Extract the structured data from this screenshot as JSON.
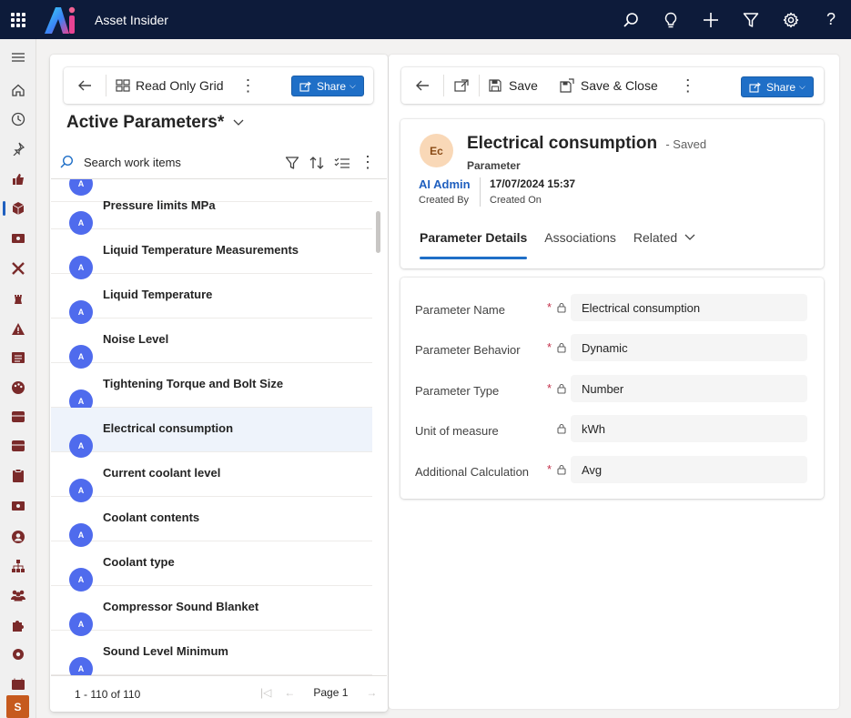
{
  "app": {
    "title": "Asset Insider"
  },
  "topbar": {
    "icons": [
      "search-icon",
      "lightbulb-icon",
      "plus-icon",
      "filter-icon",
      "settings-icon",
      "help-icon"
    ],
    "help_glyph": "?"
  },
  "leftnav": {
    "icons": [
      "hamburger-icon",
      "home-icon",
      "recent-icon",
      "pin-icon",
      "thumbs-up-icon",
      "cube-icon",
      "ticket-icon",
      "tools-icon",
      "chess-icon",
      "warning-icon",
      "list-icon",
      "palette-icon",
      "box-icon",
      "box-icon-2",
      "clipboard-icon",
      "ticket-icon-2",
      "contact-icon",
      "hierarchy-icon",
      "people-icon",
      "puzzle-icon",
      "gear-icon",
      "calendar-icon"
    ],
    "user_initial": "S"
  },
  "list_panel": {
    "toolbar": {
      "view_label": "Read Only Grid",
      "share_label": "Share"
    },
    "view_title": "Active Parameters*",
    "search_placeholder": "Search work items",
    "items": [
      {
        "initial": "A",
        "label": "Pressure limits MPa"
      },
      {
        "initial": "A",
        "label": "Liquid Temperature Measurements"
      },
      {
        "initial": "A",
        "label": "Liquid Temperature"
      },
      {
        "initial": "A",
        "label": "Noise Level"
      },
      {
        "initial": "A",
        "label": "Tightening Torque and Bolt Size"
      },
      {
        "initial": "A",
        "label": "Electrical consumption"
      },
      {
        "initial": "A",
        "label": "Current coolant level"
      },
      {
        "initial": "A",
        "label": "Coolant contents"
      },
      {
        "initial": "A",
        "label": "Coolant type"
      },
      {
        "initial": "A",
        "label": "Compressor Sound Blanket"
      },
      {
        "initial": "A",
        "label": "Sound Level Minimum"
      }
    ],
    "selected_index": 5,
    "footer": {
      "count_text": "1 - 110 of 110",
      "page_text": "Page 1"
    }
  },
  "record": {
    "toolbar": {
      "save_label": "Save",
      "save_close_label": "Save & Close",
      "share_label": "Share"
    },
    "avatar_initials": "Ec",
    "title": "Electrical consumption",
    "saved_status": "- Saved",
    "entity": "Parameter",
    "created_by_value": "AI Admin",
    "created_by_label": "Created By",
    "created_on_value": "17/07/2024 15:37",
    "created_on_label": "Created On",
    "tabs": [
      "Parameter Details",
      "Associations",
      "Related"
    ],
    "fields": [
      {
        "label": "Parameter Name",
        "required": "*",
        "value": "Electrical consumption"
      },
      {
        "label": "Parameter Behavior",
        "required": "*",
        "value": "Dynamic"
      },
      {
        "label": "Parameter Type",
        "required": "*",
        "value": "Number"
      },
      {
        "label": "Unit of measure",
        "required": "",
        "value": "kWh"
      },
      {
        "label": "Additional Calculation",
        "required": "*",
        "value": "Avg"
      }
    ]
  },
  "colors": {
    "topbar": "#0d1b3a",
    "accent": "#1f6fc7",
    "list_avatar": "#4f6bed",
    "record_avatar": "#f9d8b7",
    "required": "#c4314b",
    "user_avatar": "#c65a1e"
  }
}
